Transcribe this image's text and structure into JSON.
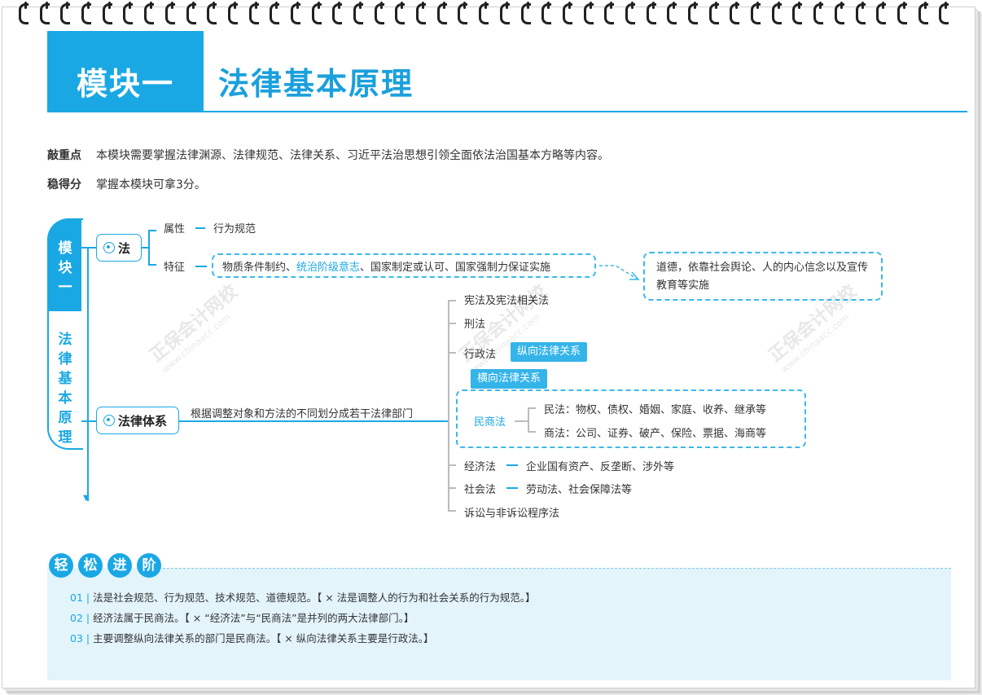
{
  "header": {
    "module": "模块一",
    "title": "法律基本原理"
  },
  "intro": {
    "key_label": "敲重点",
    "key_text": "本模块需要掌握法律渊源、法律规范、法律关系、习近平法治思想引领全面依法治国基本方略等内容。",
    "score_label": "稳得分",
    "score_text": "掌握本模块可拿3分。"
  },
  "side": {
    "top": [
      "模",
      "块",
      "一"
    ],
    "bottom": [
      "法",
      "律",
      "基",
      "本",
      "原",
      "理"
    ]
  },
  "law": {
    "label": "法",
    "attr_label": "属性",
    "attr_value": "行为规范",
    "feature_label": "特征",
    "feature_a": "物质条件制约、",
    "feature_b": "统治阶级意志",
    "feature_c": "、国家制定或认可、国家强制力保证实施",
    "note": "道德，依靠社会舆论、人的内心信念以及宣传教育等实施"
  },
  "system": {
    "label": "法律体系",
    "desc": "根据调整对象和方法的不同划分成若干法律部门",
    "items": {
      "constitution": "宪法及宪法相关法",
      "criminal": "刑法",
      "admin": "行政法",
      "admin_tag": "纵向法律关系",
      "horizontal_tag": "横向法律关系",
      "civil_commercial": "民商法",
      "civil": "民法：物权、债权、婚姻、家庭、收养、继承等",
      "commercial": "商法：公司、证券、破产、保险、票据、海商等",
      "economic": "经济法",
      "economic_value": "企业国有资产、反垄断、涉外等",
      "social": "社会法",
      "social_value": "劳动法、社会保障法等",
      "procedure": "诉讼与非诉讼程序法"
    }
  },
  "watermark": {
    "name": "正保会计网校",
    "url": "www.chinaacc.com"
  },
  "practice": {
    "badges": [
      "轻",
      "松",
      "进",
      "阶"
    ],
    "items": [
      {
        "num": "01 |",
        "text": "法是社会规范、行为规范、技术规范、道德规范。【 × 法是调整人的行为和社会关系的行为规范。】"
      },
      {
        "num": "02 |",
        "text": "经济法属于民商法。【 × “经济法”与“民商法”是并列的两大法律部门。】"
      },
      {
        "num": "03 |",
        "text": "主要调整纵向法律关系的部门是民商法。【 × 纵向法律关系主要是行政法。】"
      }
    ]
  }
}
